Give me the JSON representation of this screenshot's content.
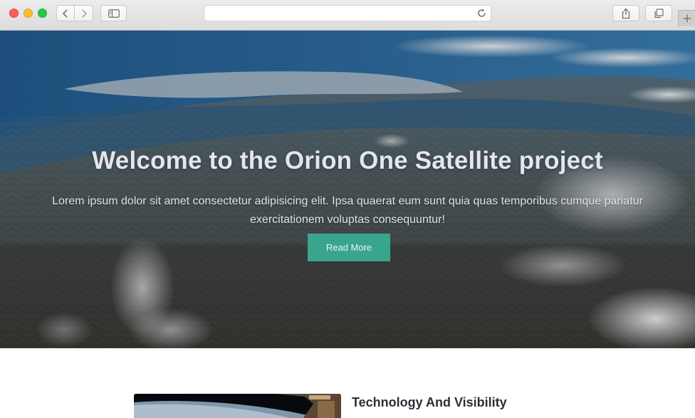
{
  "browser": {
    "address_value": "",
    "icons": {
      "back": "chevron-left-icon",
      "forward": "chevron-right-icon",
      "sidebar": "sidebar-icon",
      "reload": "reload-icon",
      "share": "share-icon",
      "tabs": "tabs-icon",
      "new_tab": "plus-icon"
    }
  },
  "hero": {
    "title": "Welcome to the Orion One Satellite project",
    "text": "Lorem ipsum dolor sit amet consectetur adipisicing elit. Ipsa quaerat eum sunt quia quas temporibus cumque pariatur exercitationem voluptas consequuntur!",
    "button_label": "Read More",
    "button_color": "#3aa58f"
  },
  "section": {
    "title": "Technology And Visibility"
  }
}
